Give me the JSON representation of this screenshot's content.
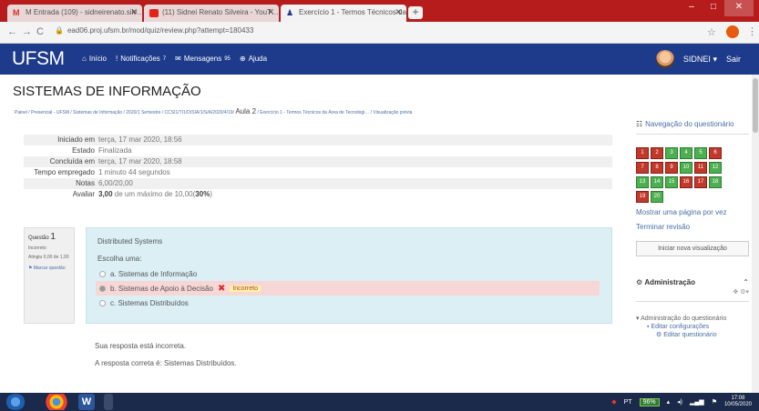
{
  "browser": {
    "tabs": [
      {
        "title": "M Entrada (109) - sidneirenato.silv…",
        "favicon": "gmail-icon"
      },
      {
        "title": "(11) Sidnei Renato Silveira - YouT…",
        "favicon": "youtube-icon"
      },
      {
        "title": "Exercício 1 - Termos Técnicos da …",
        "favicon": "moodle-icon"
      }
    ],
    "url": "ead06.proj.ufsm.br/mod/quiz/review.php?attempt=180433"
  },
  "navbar": {
    "brand": "UFSM",
    "links": [
      {
        "label": "Início"
      },
      {
        "label": "Notificações",
        "count": "7"
      },
      {
        "label": "Mensagens",
        "count": "95"
      },
      {
        "label": "Ajuda"
      }
    ],
    "user": "SIDNEI",
    "logout": "Sair"
  },
  "page": {
    "title": "SISTEMAS DE INFORMAÇÃO",
    "breadcrumb": "Painel / Presencial - UFSM / Sistemas de Informação / 2020/1 Semestre / CCSI1/TI1/D/SIA/1/S/A/2020/4/19/",
    "breadcrumb_current": "Aula 2",
    "breadcrumb_tail": " / Exercício 1 - Termos Técnicos da Área de Tecnologi… / Visualização prévia"
  },
  "summary": [
    {
      "label": "Iniciado em",
      "value": "terça, 17 mar 2020, 18:56"
    },
    {
      "label": "Estado",
      "value": "Finalizada"
    },
    {
      "label": "Concluída em",
      "value": "terça, 17 mar 2020, 18:58"
    },
    {
      "label": "Tempo empregado",
      "value": "1 minuto 44 segundos"
    },
    {
      "label": "Notas",
      "value": "6,00/20,00"
    },
    {
      "label": "Avaliar",
      "value_bold": "3,00",
      "value_rest": " de um máximo de 10,00(",
      "value_pct": "30%",
      "value_end": ")"
    }
  ],
  "question_info": {
    "label": "Questão",
    "number": "1",
    "state": "Incorreto",
    "grade": "Atingiu 0,00 de 1,00",
    "flag": "Marcar questão"
  },
  "question": {
    "text": "Distributed Systems",
    "prompt": "Escolha uma:",
    "options": [
      {
        "label": "a. Sistemas de Informação",
        "checked": false
      },
      {
        "label": "b. Sistemas de Apoio à Decisão",
        "checked": true,
        "mark": "Incorreto"
      },
      {
        "label": "c. Sistemas Distribuídos",
        "checked": false
      }
    ]
  },
  "feedback": {
    "line1": "Sua resposta está incorreta.",
    "line2": "A resposta correta é: Sistemas Distribuídos."
  },
  "sidebar": {
    "nav_title": "Navegação do questionário",
    "question_states": [
      {
        "n": "1",
        "state": "red"
      },
      {
        "n": "2",
        "state": "red"
      },
      {
        "n": "3",
        "state": "green"
      },
      {
        "n": "4",
        "state": "green"
      },
      {
        "n": "5",
        "state": "green"
      },
      {
        "n": "6",
        "state": "red"
      },
      {
        "n": "7",
        "state": "red"
      },
      {
        "n": "8",
        "state": "red"
      },
      {
        "n": "9",
        "state": "red"
      },
      {
        "n": "10",
        "state": "green"
      },
      {
        "n": "11",
        "state": "red"
      },
      {
        "n": "12",
        "state": "green"
      },
      {
        "n": "13",
        "state": "green"
      },
      {
        "n": "14",
        "state": "green"
      },
      {
        "n": "15",
        "state": "green"
      },
      {
        "n": "16",
        "state": "red"
      },
      {
        "n": "17",
        "state": "red"
      },
      {
        "n": "18",
        "state": "green"
      },
      {
        "n": "19",
        "state": "red"
      },
      {
        "n": "20",
        "state": "green"
      }
    ],
    "show_one_page": "Mostrar uma página por vez",
    "finish_review": "Terminar revisão",
    "new_preview": "Iniciar nova visualização",
    "admin_title": "Administração",
    "admin_items": [
      {
        "label": "Administração do questionário",
        "level": 0
      },
      {
        "label": "Editar configurações",
        "level": 1
      },
      {
        "label": "Editar questionário",
        "level": 2
      }
    ]
  },
  "taskbar": {
    "lang": "PT",
    "battery": "96%",
    "time": "17:08",
    "date": "10/05/2020"
  }
}
